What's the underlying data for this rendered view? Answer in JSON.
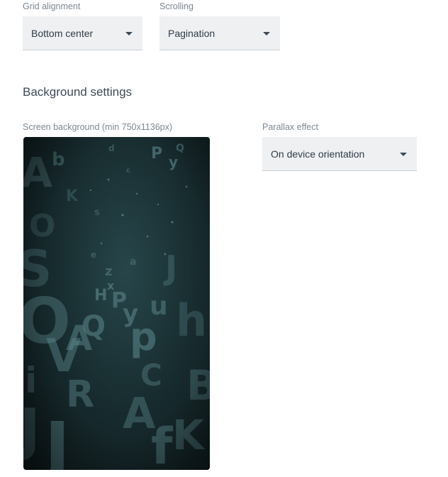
{
  "grid_alignment": {
    "label": "Grid alignment",
    "value": "Bottom center"
  },
  "scrolling": {
    "label": "Scrolling",
    "value": "Pagination"
  },
  "background_settings": {
    "title": "Background settings",
    "screen_background_label": "Screen background (min 750x1136px)",
    "parallax_label": "Parallax effect",
    "parallax_value": "On device orientation"
  },
  "colors": {
    "label_text": "#7d8893",
    "select_bg": "#eef0f2",
    "preview_glyph": "#5f8a8f",
    "preview_bg": "#16292c"
  },
  "icons": {
    "dropdown": "caret-down-icon"
  }
}
